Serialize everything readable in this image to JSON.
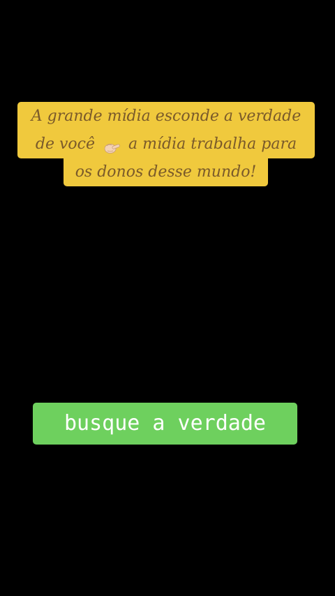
{
  "caption": {
    "line1": "A grande mídia esconde a verdade",
    "line2_before_icon": "de você",
    "line2_after_icon": "a mídia trabalha para",
    "line3": "os donos desse mundo!",
    "icon": "pointing-finger-icon"
  },
  "label": {
    "text": "busque a verdade"
  },
  "colors": {
    "background": "#000000",
    "caption_bg": "#f0c93d",
    "caption_text": "#7a5a2a",
    "label_bg": "#6ed05e",
    "label_text": "#ffffff"
  }
}
